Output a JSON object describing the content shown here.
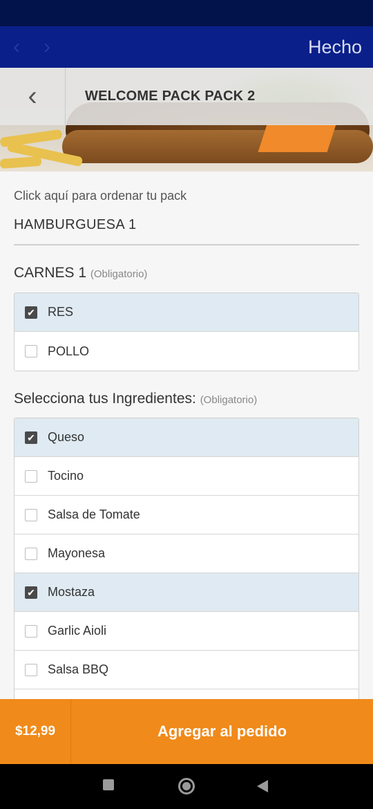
{
  "nav": {
    "back_arrow": "‹",
    "forward_arrow": "›",
    "done_label": "Hecho"
  },
  "header": {
    "back_icon": "‹",
    "title": "WELCOME PACK PACK 2"
  },
  "intro": {
    "hint": "Click aquí para ordenar tu pack",
    "item_name": "HAMBURGUESA 1"
  },
  "carnes": {
    "title": "CARNES 1",
    "required": "(Obligatorio)",
    "options": [
      {
        "label": "RES",
        "checked": true
      },
      {
        "label": "POLLO",
        "checked": false
      }
    ]
  },
  "ingredientes": {
    "title": "Selecciona tus Ingredientes:",
    "required": "(Obligatorio)",
    "options": [
      {
        "label": "Queso",
        "checked": true
      },
      {
        "label": "Tocino",
        "checked": false
      },
      {
        "label": "Salsa de Tomate",
        "checked": false
      },
      {
        "label": "Mayonesa",
        "checked": false
      },
      {
        "label": "Mostaza",
        "checked": true
      },
      {
        "label": "Garlic Aioli",
        "checked": false
      },
      {
        "label": "Salsa BBQ",
        "checked": false
      },
      {
        "label": "",
        "checked": false
      }
    ]
  },
  "footer": {
    "price": "$12,99",
    "add_label": "Agregar al pedido"
  },
  "colors": {
    "nav_bg": "#0a1f8a",
    "status_bg": "#02124a",
    "accent": "#f08a1a",
    "selected_row": "#dfeaf2"
  },
  "icons": {
    "checkbox_checked": "check-icon",
    "system_recents": "square-icon",
    "system_home": "home-circle-icon",
    "system_back": "triangle-back-icon"
  }
}
